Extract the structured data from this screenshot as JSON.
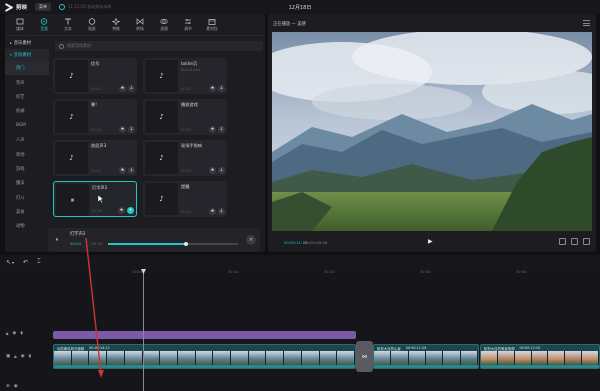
{
  "app": {
    "name": "剪映",
    "menu_label": "菜单",
    "autosave_text": "11:15:45 自动保存本地",
    "document_title": "12月18日"
  },
  "toolbar": {
    "tools": [
      {
        "label": "媒体",
        "icon": "media-icon"
      },
      {
        "label": "音频",
        "icon": "audio-icon",
        "active": true
      },
      {
        "label": "文本",
        "icon": "text-icon"
      },
      {
        "label": "贴纸",
        "icon": "sticker-icon"
      },
      {
        "label": "特效",
        "icon": "effects-icon"
      },
      {
        "label": "转场",
        "icon": "transition-icon"
      },
      {
        "label": "滤镜",
        "icon": "filter-icon"
      },
      {
        "label": "调节",
        "icon": "adjust-icon"
      },
      {
        "label": "素材包",
        "icon": "package-icon"
      }
    ]
  },
  "categories": {
    "group1": "音乐素材",
    "group2": "音效素材",
    "items": [
      "热门",
      "笑声",
      "综艺",
      "机械",
      "BGM",
      "人声",
      "转场",
      "游戏",
      "魔法",
      "打斗",
      "美食",
      "动物"
    ],
    "selected_index": 0
  },
  "search": {
    "placeholder": "搜索音效素材"
  },
  "sound_cards": [
    {
      "name": "信号",
      "sub": "",
      "duration": "00:01"
    },
    {
      "name": "tokhe沉",
      "sub": "RLD Studio",
      "duration": "00:01"
    },
    {
      "name": "暴!",
      "sub": "",
      "duration": "00:01"
    },
    {
      "name": "播放游戏",
      "sub": "",
      "duration": "00:01"
    },
    {
      "name": "放屁声3",
      "sub": "",
      "duration": "00:01"
    },
    {
      "name": "现场手指响",
      "sub": "",
      "duration": "00:01"
    },
    {
      "name": "打字声2",
      "sub": "",
      "duration": "00:04"
    },
    {
      "name": "提醒",
      "sub": "",
      "duration": "00:01"
    }
  ],
  "mini_player": {
    "title": "打字声2",
    "current": "00:04",
    "total": "00:04",
    "progress": 0.6
  },
  "preview": {
    "title": "正在播放 — 美感",
    "current_time": "00:00:11:19",
    "total_time": "00:02:00:16"
  },
  "timeline": {
    "ruler_labels": [
      "100:00",
      "00:10",
      "00:20",
      "00:30",
      "00:40",
      "00:50"
    ],
    "clips": [
      {
        "title": "动态素材风光视频",
        "time": "00:00:14:12"
      },
      {
        "title": "航拍大自然山景",
        "time": "00:00:11:26"
      },
      {
        "title": "航拍大自然美景视频",
        "time": "00:00:12:10"
      }
    ]
  },
  "colors": {
    "accent": "#22c6c6",
    "audio_clip": "#7b5aa8",
    "video_clip": "#1f4d53"
  }
}
